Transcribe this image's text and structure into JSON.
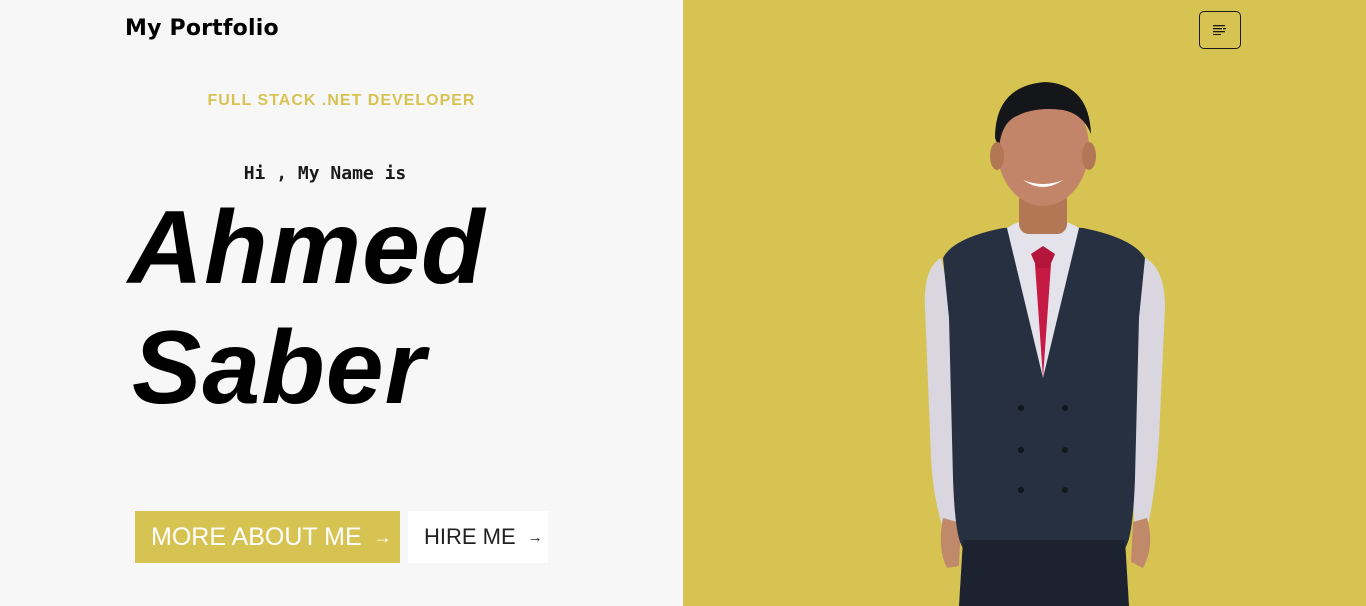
{
  "header": {
    "brand": "My Portfolio",
    "menu_icon": "menu-lines-icon"
  },
  "hero": {
    "subtitle": "FULL STACK .NET DEVELOPER",
    "greeting": "Hi , My Name is",
    "first_name": "Ahmed",
    "last_name": "Saber"
  },
  "buttons": {
    "about_label": "MORE ABOUT ME",
    "about_arrow": "→",
    "hire_label": "HIRE ME",
    "hire_arrow": "→"
  },
  "colors": {
    "accent": "#d6c352",
    "left_background": "#f7f7f7",
    "text_dark": "#000000"
  }
}
